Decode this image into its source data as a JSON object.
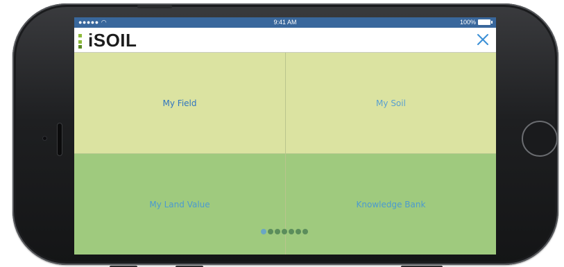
{
  "status_bar": {
    "signal": "●●●●● ",
    "time": "9:41 AM",
    "battery": "100%"
  },
  "header": {
    "logo_text": "iSOIL",
    "close_icon": "close-icon"
  },
  "tiles": [
    {
      "label": "My Field"
    },
    {
      "label": "My Soil"
    },
    {
      "label": "My Land Value"
    },
    {
      "label": "Knowledge Bank"
    }
  ],
  "pagination": {
    "total": 7,
    "active_index": 0
  },
  "colors": {
    "status_bar": "#39679c",
    "tile_top": "#dbe3a1",
    "tile_bottom": "#9fca7e",
    "link_blue": "#2f74c0",
    "logo_green": "#8dba3a"
  }
}
